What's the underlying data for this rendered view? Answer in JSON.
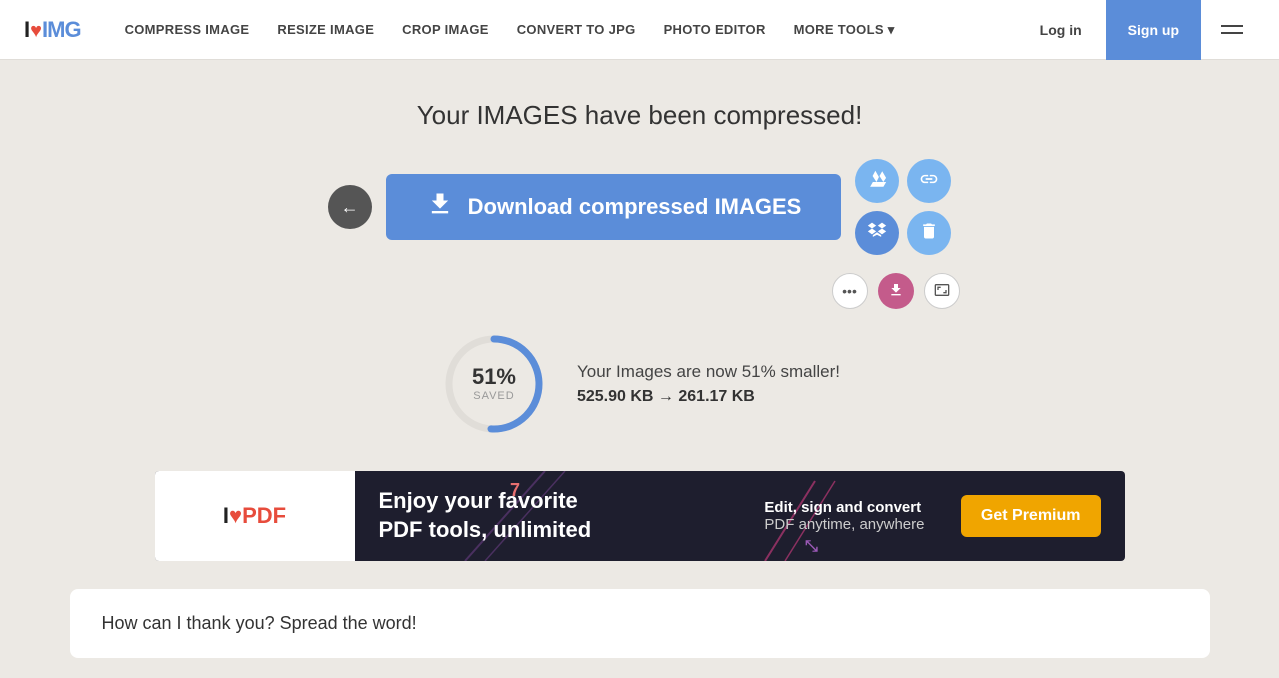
{
  "navbar": {
    "logo": {
      "i": "I",
      "heart": "♥",
      "img": "IMG"
    },
    "links": [
      {
        "label": "COMPRESS IMAGE",
        "id": "compress"
      },
      {
        "label": "RESIZE IMAGE",
        "id": "resize"
      },
      {
        "label": "CROP IMAGE",
        "id": "crop"
      },
      {
        "label": "CONVERT TO JPG",
        "id": "convert"
      },
      {
        "label": "PHOTO EDITOR",
        "id": "photo"
      },
      {
        "label": "MORE TOOLS ▾",
        "id": "more"
      }
    ],
    "login_label": "Log in",
    "signup_label": "Sign up"
  },
  "main": {
    "page_title": "Your IMAGES have been compressed!",
    "download_button_label": "Download compressed IMAGES",
    "back_icon": "←",
    "stats": {
      "percent": "51%",
      "saved_label": "SAVED",
      "description": "Your Images are now 51% smaller!",
      "sizes": "525.90 KB → 261.17 KB",
      "progress_pct": 51
    }
  },
  "action_icons": {
    "drive_label": "Google Drive",
    "link_label": "Copy Link",
    "dropbox_label": "Dropbox",
    "delete_label": "Delete"
  },
  "small_actions": {
    "dots_label": "•••",
    "download_label": "↓",
    "resize_label": "⤢"
  },
  "ad": {
    "logo_i": "I",
    "logo_heart": "♥",
    "logo_pdf": "PDF",
    "title_line1": "Enjoy your favorite",
    "title_line2": "PDF tools, unlimited",
    "right_text_line1": "Edit, sign and convert",
    "right_text_line2": "PDF anytime, anywhere",
    "cta_label": "Get Premium"
  },
  "spread": {
    "title": "How can I thank you? Spread the word!"
  }
}
